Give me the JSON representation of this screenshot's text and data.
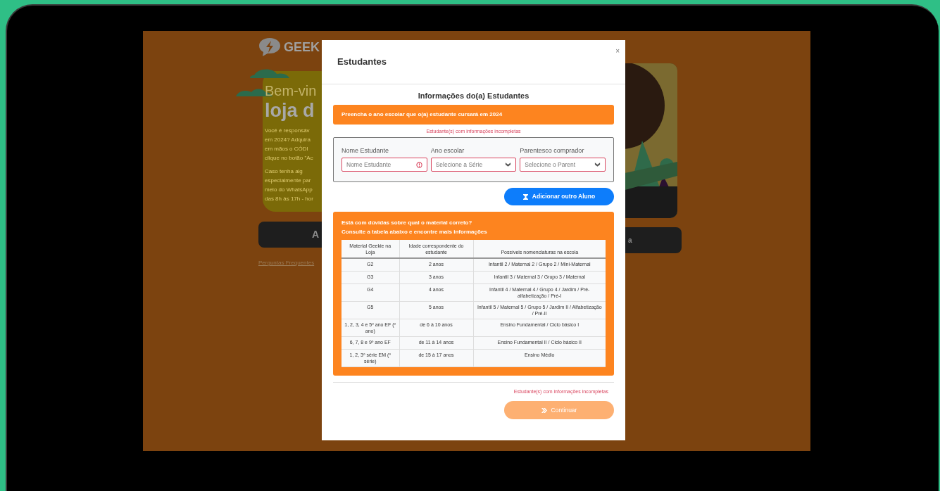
{
  "background": {
    "logo_text": "GEEK",
    "card_title": "Bem-vin",
    "card_heading": "loja d",
    "card_paragraphs": [
      "Você é responsáv em 2024? Adquira em mãos o CÓDI clique no botão \"Ac",
      "Caso tenha alg especialmente par meio do WhatsApp das 8h às 17h - hor"
    ],
    "left_button": "A",
    "right_button": "a",
    "faq_link": "Perguntas Frequentes"
  },
  "modal": {
    "title": "Estudantes",
    "close": "×",
    "section_title": "Informações do(a) Estudantes",
    "banner": "Preencha o ano escolar que o(a) estudante cursará em 2024",
    "warning_top": "Estudante(s) com informações incompletas",
    "fields": [
      {
        "kind": "text",
        "label": "Nome Estudante",
        "placeholder": "Nome Estudante",
        "invalid": true
      },
      {
        "kind": "select",
        "label": "Ano escolar",
        "placeholder": "Selecione a Série",
        "invalid": true
      },
      {
        "kind": "select",
        "label": "Parentesco comprador",
        "placeholder": "Selecione o Parent",
        "invalid": true
      }
    ],
    "add_button": "Adicionar outro Aluno",
    "help": {
      "lines": [
        "Está com dúvidas sobre qual o material correto?",
        "Consulte a tabela abaixo e encontre mais informações"
      ],
      "table": {
        "columns": [
          "Material Geekie na Loja",
          "Idade correspondente do estudante",
          "Possíveis nomenclaturas na escola"
        ],
        "rows": [
          [
            "G2",
            "2 anos",
            "Infantil 2 / Maternal 2 / Grupo 2 / Mini-Maternal"
          ],
          [
            "G3",
            "3 anos",
            "Infantil 3 / Maternal 3 / Grupo 3 / Maternal"
          ],
          [
            "G4",
            "4 anos",
            "Infantil 4 / Maternal 4 / Grupo 4 / Jardim / Pré-alfabetização / Pré-I"
          ],
          [
            "G5",
            "5 anos",
            "Infantil 5 / Maternal 5 / Grupo 5 / Jardim II / Alfabetização / Pré-II"
          ],
          [
            "1, 2, 3, 4 e 5º ano EF (º ano)",
            "de 6 à 10 anos",
            "Ensino Fundamental / Ciclo básico I"
          ],
          [
            "6, 7, 8 e 9º ano EF",
            "de 11 à 14 anos",
            "Ensino Fundamental II / Ciclo básico II"
          ],
          [
            "1, 2, 3º série EM (º série)",
            "de 15 à 17 anos",
            "Ensino Médio"
          ]
        ]
      }
    },
    "warning_bottom": "Estudante(s) com informações incompletas",
    "continue_button": {
      "label": "Continuar",
      "disabled": true
    }
  }
}
